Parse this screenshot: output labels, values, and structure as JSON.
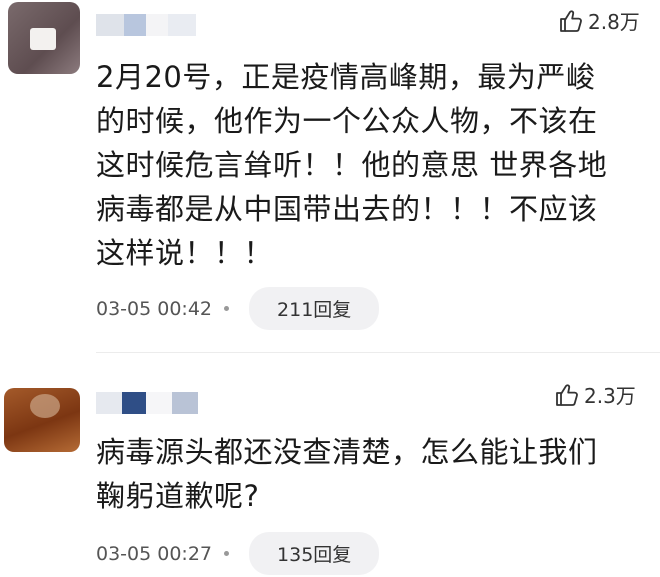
{
  "comments": [
    {
      "likes": "2.8万",
      "text": "2月20号，正是疫情高峰期，最为严峻\n的时候，他作为一个公众人物，不该在\n这时候危言耸听！！他的意思 世界各地\n病毒都是从中国带出去的！！！不应该\n这样说！！！",
      "time": "03-05 00:42",
      "reply": "211回复"
    },
    {
      "likes": "2.3万",
      "text": "病毒源头都还没查清楚，怎么能让我们\n鞠躬道歉呢?",
      "time": "03-05 00:27",
      "reply": "135回复"
    }
  ],
  "icons": {
    "like": "thumbs-up-icon"
  },
  "colors": {
    "text": "#1a1a1a",
    "meta": "#555555",
    "pill": "#f1f1f3"
  }
}
